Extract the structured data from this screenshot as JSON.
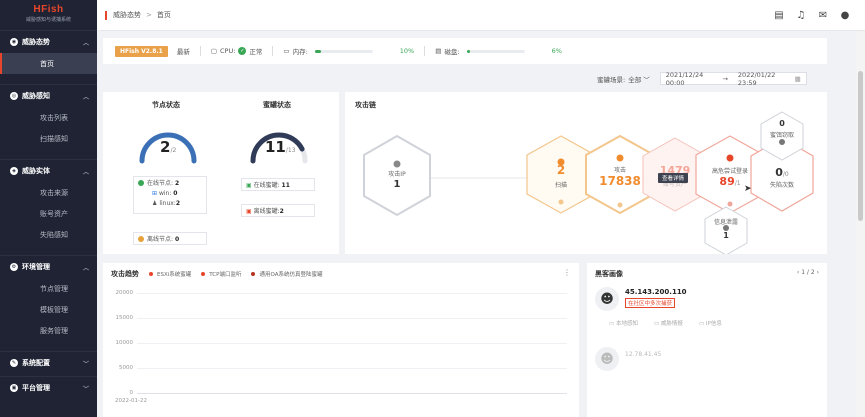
{
  "brand": {
    "logo": "HFish",
    "subtitle": "威胁感知与诱捕系统"
  },
  "sidebar": {
    "groups": [
      {
        "label": "威胁态势",
        "items": [
          {
            "label": "首页"
          }
        ]
      },
      {
        "label": "威胁感知",
        "items": [
          {
            "label": "攻击列表"
          },
          {
            "label": "扫描感知"
          }
        ]
      },
      {
        "label": "威胁实体",
        "items": [
          {
            "label": "攻击来源"
          },
          {
            "label": "账号资产"
          },
          {
            "label": "失陷感知"
          }
        ]
      },
      {
        "label": "环境管理",
        "items": [
          {
            "label": "节点管理"
          },
          {
            "label": "模板管理"
          },
          {
            "label": "服务管理"
          }
        ]
      },
      {
        "label": "系统配置",
        "items": []
      },
      {
        "label": "平台管理",
        "items": []
      }
    ]
  },
  "header": {
    "breadcrumb": [
      "威胁态势",
      "首页"
    ]
  },
  "status": {
    "version": "HFish V2.8.1",
    "latest": "最新",
    "cpu_label": "CPU:",
    "cpu_state": "正常",
    "mem_label": "内存:",
    "mem_pct": "10%",
    "mem_fraction": 0.1,
    "disk_label": "磁盘:",
    "disk_pct": "6%",
    "disk_fraction": 0.06
  },
  "filter": {
    "scene_label": "蜜罐场景:",
    "scene_value": "全部",
    "date_start": "2021/12/24 00:00",
    "date_sep": "→",
    "date_end": "2022/01/22 23:59"
  },
  "node_status": {
    "title": "节点状态",
    "value": "2",
    "total": "/2",
    "online_label": "在线节点:",
    "online_value": "2",
    "win_label": "win:",
    "win_value": "0",
    "linux_label": "linux:",
    "linux_value": "2",
    "offline_label": "离线节点:",
    "offline_value": "0",
    "fraction": 1.0
  },
  "honeypot_status": {
    "title": "蜜罐状态",
    "value": "11",
    "total": "/13",
    "online_label": "在线蜜罐:",
    "online_value": "11",
    "offline_label": "离线蜜罐:",
    "offline_value": "2",
    "fraction": 0.846
  },
  "attack_chain": {
    "title": "攻击链",
    "source_label": "攻击IP",
    "source_value": "1",
    "scan_label": "扫描",
    "scan_value": "2",
    "attack_label": "攻击",
    "attack_value": "17838",
    "tooltip": "查看详情",
    "account_label": "账号资产",
    "account_value": "1479",
    "brute_label": "高危尝试登录",
    "brute_value": "89",
    "brute_total": "/1",
    "fall_label": "失陷次数",
    "fall_value": "0",
    "fall_total": "/0",
    "bait_label": "蜜饵窃取",
    "bait_value": "0",
    "info_label": "信息泄露",
    "info_value": "1",
    "colors": {
      "orange": "#f08c2e",
      "red": "#e8462b",
      "gray": "#777777"
    }
  },
  "attack_trend": {
    "title": "攻击趋势",
    "legend": [
      {
        "label": "ESXi系统蜜罐",
        "color": "#e8462b"
      },
      {
        "label": "TCP端口监听",
        "color": "#e8462b"
      },
      {
        "label": "通用OA系统仿真登陆蜜罐",
        "color": "#b4341f"
      }
    ],
    "y_ticks": [
      "20000",
      "15000",
      "10000",
      "5000",
      "0"
    ],
    "x_label": "2022-01-22"
  },
  "hacker_profile": {
    "title": "黑客画像",
    "pager": "1 / 2",
    "ip": "45.143.200.110",
    "tag": "在社区中多次捕获",
    "actions": [
      "本地感知",
      "威胁情报",
      "IP信息"
    ],
    "ip2": "12.78.41.45"
  }
}
